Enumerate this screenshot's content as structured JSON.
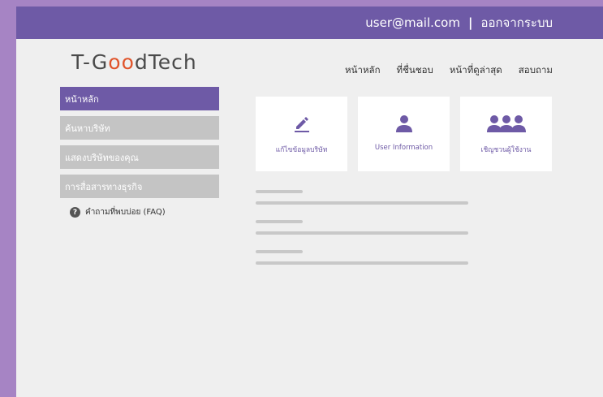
{
  "header": {
    "user_email": "user@mail.com",
    "divider": "|",
    "logout_label": "ออกจากระบบ"
  },
  "logo": {
    "prefix": "T-G",
    "accent": "oo",
    "suffix": "dTech"
  },
  "topnav": [
    "หน้าหลัก",
    "ที่ชื่นชอบ",
    "หน้าที่ดูล่าสุด",
    "สอบถาม"
  ],
  "sidebar": {
    "items": [
      {
        "label": "หน้าหลัก",
        "active": true
      },
      {
        "label": "ค้นหาบริษัท",
        "active": false
      },
      {
        "label": "แสดงบริษัทของคุณ",
        "active": false
      },
      {
        "label": "การสื่อสารทางธุรกิจ",
        "active": false
      }
    ],
    "faq": {
      "icon_text": "?",
      "label": "คำถามที่พบบ่อย (FAQ)"
    }
  },
  "cards": [
    {
      "icon": "pencil-icon",
      "label": "แก้ไขข้อมูลบริษัท"
    },
    {
      "icon": "user-icon",
      "label": "User Information"
    },
    {
      "icon": "users-group-icon",
      "label": "เชิญชวนผู้ใช้งาน"
    }
  ],
  "colors": {
    "primary": "#6e5aa6",
    "background": "#a684c4",
    "logo_accent": "#e0542b",
    "inactive_sidebar": "#c4c4c4"
  }
}
